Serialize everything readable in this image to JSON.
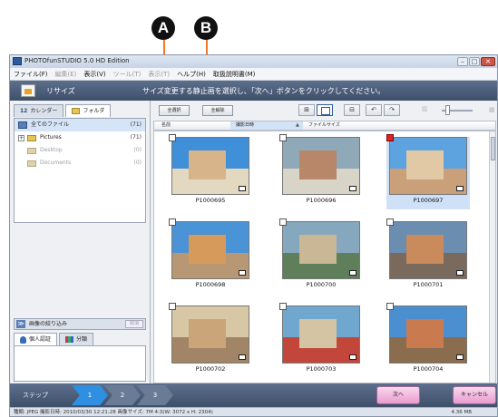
{
  "callouts": {
    "a": "A",
    "b": "B"
  },
  "window": {
    "title": "PHOTOfunSTUDIO 5.0 HD Edition",
    "minimize": "–",
    "maximize": "□",
    "close": "✕"
  },
  "menu": [
    {
      "label": "ファイル(F)",
      "enabled": true
    },
    {
      "label": "編集(E)",
      "enabled": false
    },
    {
      "label": "表示(V)",
      "enabled": true
    },
    {
      "label": "ツール(T)",
      "enabled": false
    },
    {
      "label": "表示(T)",
      "enabled": false
    },
    {
      "label": "ヘルプ(H)",
      "enabled": true
    },
    {
      "label": "取扱説明書(M)",
      "enabled": true
    }
  ],
  "mode": {
    "title": "リサイズ",
    "instruction": "サイズ変更する静止画を選択し、「次へ」ボタンをクリックしてください。"
  },
  "left_tabs": {
    "calendar": "カレンダー",
    "calendar_glyph": "12",
    "folder": "フォルダ"
  },
  "folder_tree": [
    {
      "label": "全てのファイル",
      "count": "(71)"
    },
    {
      "label": "Pictures",
      "count": "(71)"
    },
    {
      "label": "Desktop",
      "count": "(0)"
    },
    {
      "label": "Documents",
      "count": "(0)"
    }
  ],
  "refine": {
    "label": "画像の絞り込み",
    "button": "取消",
    "icon": "≫"
  },
  "refine_tabs": {
    "personal": "個人認証",
    "category": "分類"
  },
  "toolbar": {
    "select_all": "全選択",
    "deselect_all": "全解除"
  },
  "view_icons": [
    "⊞",
    "",
    "⊟",
    "↶",
    "↷",
    "▥",
    "▦"
  ],
  "columns": {
    "name": "名前",
    "date": "撮影日時",
    "sort_arrow": "▲",
    "size": "ファイルサイズ"
  },
  "photos": [
    {
      "label": "P1000695",
      "checked": false,
      "selected": false,
      "sky": "#3f8fd9",
      "ground": "#e3d8c0",
      "building": "#d8b48a"
    },
    {
      "label": "P1000696",
      "checked": false,
      "selected": false,
      "sky": "#8fa9b8",
      "ground": "#d9d4c8",
      "building": "#b8876a"
    },
    {
      "label": "P1000697",
      "checked": true,
      "selected": true,
      "sky": "#5da3e0",
      "ground": "#caa07a",
      "building": "#e0c9a4"
    },
    {
      "label": "P1000698",
      "checked": false,
      "selected": false,
      "sky": "#4a93d6",
      "ground": "#b89874",
      "building": "#d69a5a"
    },
    {
      "label": "P1000700",
      "checked": false,
      "selected": false,
      "sky": "#86a8bf",
      "ground": "#5f7f5a",
      "building": "#c9b796"
    },
    {
      "label": "P1000701",
      "checked": false,
      "selected": false,
      "sky": "#6b8db0",
      "ground": "#7a6a5e",
      "building": "#c98a5c"
    },
    {
      "label": "P1000702",
      "checked": false,
      "selected": false,
      "sky": "#d7c7a4",
      "ground": "#a28466",
      "building": "#caa57a"
    },
    {
      "label": "P1000703",
      "checked": false,
      "selected": false,
      "sky": "#6fa7cf",
      "ground": "#c2473a",
      "building": "#d4c4a4"
    },
    {
      "label": "P1000704",
      "checked": false,
      "selected": false,
      "sky": "#4c8fd1",
      "ground": "#8a6c4e",
      "building": "#c97a4e"
    }
  ],
  "steps": {
    "label": "ステップ",
    "items": [
      "1",
      "2",
      "3"
    ],
    "active": 1
  },
  "buttons": {
    "next": "次へ",
    "cancel": "キャンセル"
  },
  "status": {
    "info": "種類: JPEG  撮影日時: 2010/03/30 12:21:28  画像サイズ: 7M 4:3(W: 3072 x H: 2304)",
    "size": "4.36 MB"
  },
  "colors": {
    "accent_orange": "#f07a2a",
    "mode_bar": "#4a5b77",
    "step_active": "#2f8fe0",
    "action_pink": "#f0b4dc"
  }
}
